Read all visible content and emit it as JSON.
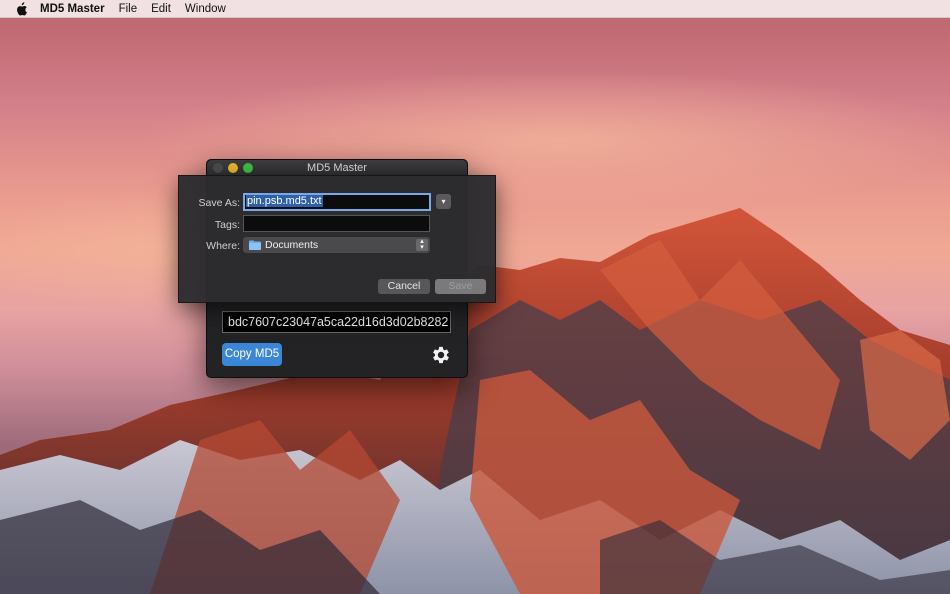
{
  "menubar": {
    "app_name": "MD5 Master",
    "items": [
      "File",
      "Edit",
      "Window"
    ]
  },
  "window": {
    "title": "MD5 Master",
    "md5_hash": "bdc7607c23047a5ca22d16d3d02b8282",
    "copy_button": "Copy MD5"
  },
  "save_sheet": {
    "save_as_label": "Save As:",
    "save_as_value": "pin.psb.md5.txt",
    "tags_label": "Tags:",
    "tags_value": "",
    "where_label": "Where:",
    "where_value": "Documents",
    "cancel_button": "Cancel",
    "save_button": "Save"
  },
  "colors": {
    "accent": "#3b86d6",
    "minimize": "#e7b32e",
    "maximize": "#3fbd40"
  },
  "icons": [
    "apple-icon",
    "gear-icon",
    "folder-icon",
    "chevron-down-icon",
    "stepper-icon"
  ]
}
